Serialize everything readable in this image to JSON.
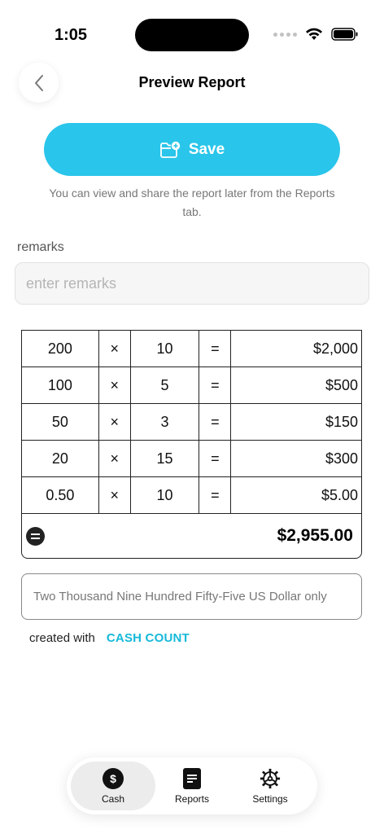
{
  "status": {
    "time": "1:05"
  },
  "header": {
    "title": "Preview Report"
  },
  "save": {
    "label": "Save",
    "hint": "You can view and share the report later from the Reports tab."
  },
  "remarks": {
    "label": "remarks",
    "placeholder": "enter remarks",
    "value": ""
  },
  "table": {
    "rows": [
      {
        "denomination": "200",
        "times": "×",
        "count": "10",
        "equals": "=",
        "amount": "$2,000"
      },
      {
        "denomination": "100",
        "times": "×",
        "count": "5",
        "equals": "=",
        "amount": "$500"
      },
      {
        "denomination": "50",
        "times": "×",
        "count": "3",
        "equals": "=",
        "amount": "$150"
      },
      {
        "denomination": "20",
        "times": "×",
        "count": "15",
        "equals": "=",
        "amount": "$300"
      },
      {
        "denomination": "0.50",
        "times": "×",
        "count": "10",
        "equals": "=",
        "amount": "$5.00"
      }
    ]
  },
  "total": {
    "value": "$2,955.00",
    "icon": "equals-icon"
  },
  "words": {
    "text": "Two Thousand Nine Hundred Fifty-Five US Dollar only"
  },
  "credit": {
    "prefix": "created with",
    "brand": "CASH COUNT"
  },
  "tabs": [
    {
      "label": "Cash",
      "icon": "dollar-icon",
      "active": true,
      "symbol": "$"
    },
    {
      "label": "Reports",
      "icon": "document-icon",
      "active": false
    },
    {
      "label": "Settings",
      "icon": "gear-icon",
      "active": false
    }
  ],
  "colors": {
    "accent": "#2ac5ea",
    "brand_text": "#16b9d9"
  }
}
